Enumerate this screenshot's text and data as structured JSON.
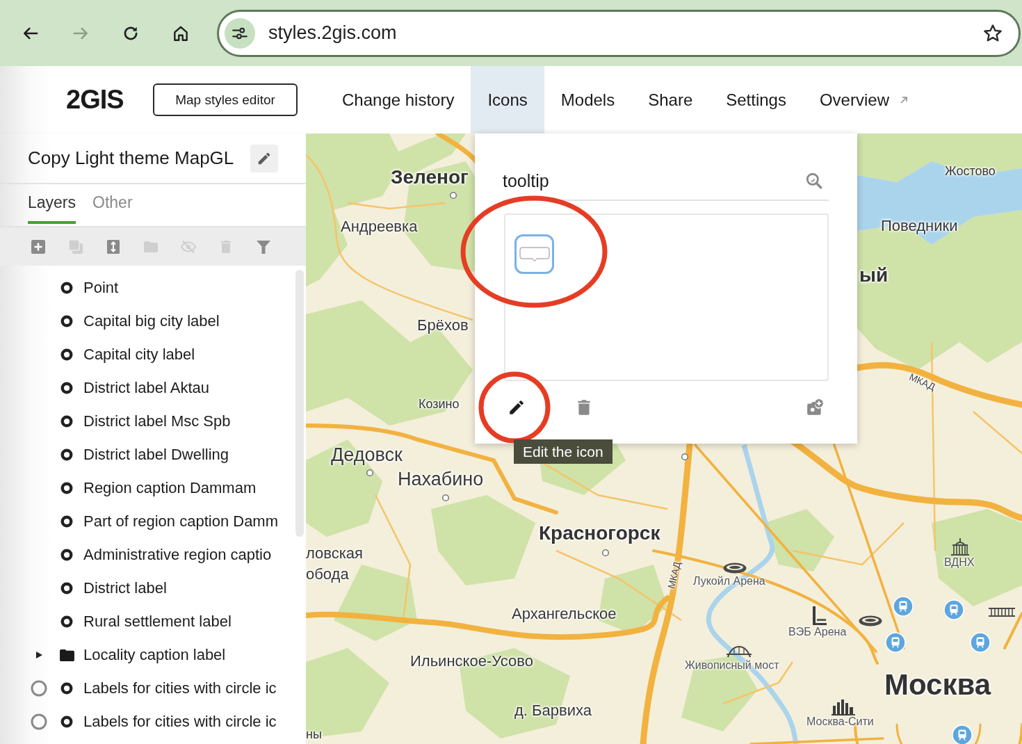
{
  "browser": {
    "nav_buttons": [
      {
        "kind": "back",
        "disabled": false
      },
      {
        "kind": "forward",
        "disabled": true
      },
      {
        "kind": "reload",
        "disabled": false
      },
      {
        "kind": "home",
        "disabled": false
      }
    ],
    "url": "styles.2gis.com"
  },
  "header": {
    "logo": "2GIS",
    "editor_button": "Map styles editor",
    "nav": [
      {
        "label": "Change history",
        "selected": false,
        "external": false
      },
      {
        "label": "Icons",
        "selected": true,
        "external": false
      },
      {
        "label": "Models",
        "selected": false,
        "external": false
      },
      {
        "label": "Share",
        "selected": false,
        "external": false
      },
      {
        "label": "Settings",
        "selected": false,
        "external": false
      },
      {
        "label": "Overview",
        "selected": false,
        "external": true
      }
    ]
  },
  "sidebar": {
    "title": "Copy Light theme MapGL",
    "tabs": [
      {
        "label": "Layers",
        "selected": true
      },
      {
        "label": "Other",
        "selected": false
      }
    ],
    "toolbar": [
      {
        "kind": "add",
        "disabled": false
      },
      {
        "kind": "copy",
        "disabled": true
      },
      {
        "kind": "sort",
        "disabled": false
      },
      {
        "kind": "folder",
        "disabled": true
      },
      {
        "kind": "hide",
        "disabled": true
      },
      {
        "kind": "delete",
        "disabled": true
      },
      {
        "kind": "filter",
        "disabled": false
      }
    ],
    "layers": [
      {
        "label": "Point",
        "kind": "point",
        "ring": false
      },
      {
        "label": "Capital big city label",
        "kind": "point",
        "ring": false
      },
      {
        "label": "Capital city label",
        "kind": "point",
        "ring": false
      },
      {
        "label": "District label Aktau",
        "kind": "point",
        "ring": false
      },
      {
        "label": "District label Msc Spb",
        "kind": "point",
        "ring": false
      },
      {
        "label": "District label Dwelling",
        "kind": "point",
        "ring": false
      },
      {
        "label": "Region caption Dammam",
        "kind": "point",
        "ring": false
      },
      {
        "label": "Part of region caption Damm",
        "kind": "point",
        "ring": false
      },
      {
        "label": "Administrative region captio",
        "kind": "point",
        "ring": false
      },
      {
        "label": "District label",
        "kind": "point",
        "ring": false
      },
      {
        "label": "Rural settlement label",
        "kind": "point",
        "ring": false
      },
      {
        "label": "Locality caption label",
        "kind": "folder",
        "expanded": false,
        "ring": false
      },
      {
        "label": "Labels for cities with circle ic",
        "kind": "point",
        "ring": true
      },
      {
        "label": "Labels for cities with circle ic",
        "kind": "point",
        "ring": true
      }
    ]
  },
  "icons_popup": {
    "search": {
      "value": "tooltip"
    },
    "icons": [
      {
        "selected": true
      }
    ],
    "actions": [
      {
        "kind": "edit"
      },
      {
        "kind": "delete"
      },
      {
        "kind": "add_image"
      }
    ],
    "tooltip": "Edit the icon"
  },
  "annotations": [
    {
      "kind": "ellipse"
    },
    {
      "kind": "circle"
    }
  ],
  "map": {
    "labels": [
      {
        "text": "Зеленог",
        "kind": "city"
      },
      {
        "text": "Андреевка",
        "kind": "village"
      },
      {
        "text": "Брёхов",
        "kind": "village"
      },
      {
        "text": "Козино",
        "kind": "hamlet"
      },
      {
        "text": "Дедовск",
        "kind": "town"
      },
      {
        "text": "Нахабино",
        "kind": "town"
      },
      {
        "text": "Красногорск",
        "kind": "city"
      },
      {
        "text": "ловская",
        "kind": "village"
      },
      {
        "text": "обода",
        "kind": "village"
      },
      {
        "text": "Архангельское",
        "kind": "village"
      },
      {
        "text": "Ильинское-Усово",
        "kind": "village"
      },
      {
        "text": "д. Барвиха",
        "kind": "village"
      },
      {
        "text": "ны",
        "kind": "hamlet"
      },
      {
        "text": "Жостово",
        "kind": "hamlet"
      },
      {
        "text": "Поведники",
        "kind": "village"
      },
      {
        "text": "ый",
        "kind": "city"
      },
      {
        "text": "МКАД",
        "kind": "road"
      },
      {
        "text": "МКАД",
        "kind": "road"
      },
      {
        "text": "Лукойл Арена",
        "kind": "poi"
      },
      {
        "text": "ВЭБ Арена",
        "kind": "poi"
      },
      {
        "text": "Живописный мост",
        "kind": "poi"
      },
      {
        "text": "ВДНХ",
        "kind": "poi"
      },
      {
        "text": "Москва",
        "kind": "capital"
      },
      {
        "text": "Москва-Сити",
        "kind": "poi"
      }
    ]
  }
}
